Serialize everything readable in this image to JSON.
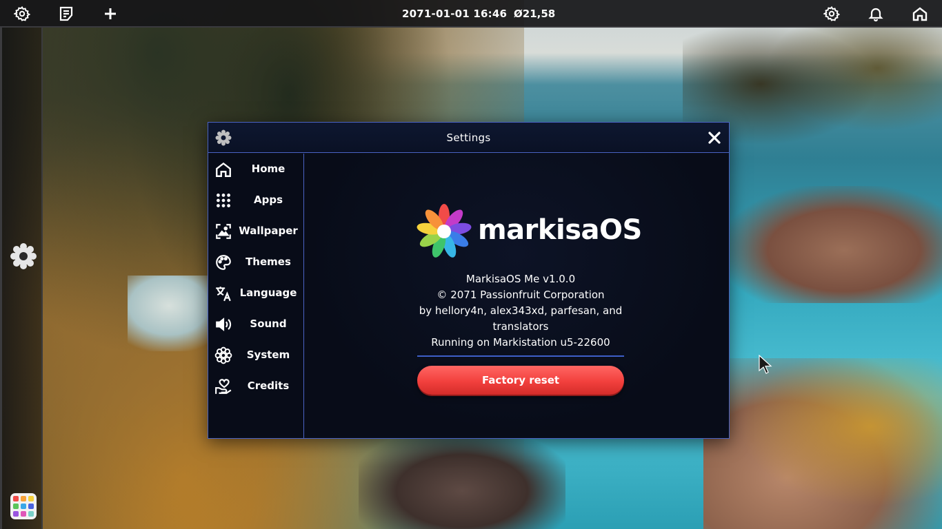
{
  "topbar": {
    "datetime": "2071-01-01 16:46",
    "battery": "Ø21,58",
    "left_icons": [
      "settings-icon",
      "notes-icon",
      "add-icon"
    ],
    "right_icons": [
      "settings-icon",
      "bell-icon",
      "home-icon"
    ]
  },
  "window": {
    "title": "Settings",
    "close_icon": "close-icon"
  },
  "sidebar": {
    "items": [
      {
        "label": "Home",
        "icon": "home-icon"
      },
      {
        "label": "Apps",
        "icon": "apps-grid-icon"
      },
      {
        "label": "Wallpaper",
        "icon": "wallpaper-icon"
      },
      {
        "label": "Themes",
        "icon": "palette-icon"
      },
      {
        "label": "Language",
        "icon": "translate-icon"
      },
      {
        "label": "Sound",
        "icon": "speaker-icon"
      },
      {
        "label": "System",
        "icon": "flower-gear-icon"
      },
      {
        "label": "Credits",
        "icon": "hand-heart-icon"
      }
    ]
  },
  "about": {
    "logo_text": "markisaOS",
    "version": "MarkisaOS Me v1.0.0",
    "copyright": "© 2071 Passionfruit Corporation",
    "authors": "by hellory4n, alex343xd, parfesan, and translators",
    "device": "Running on Markistation u5-22600",
    "factory_reset_label": "Factory reset"
  },
  "colors": {
    "window_bg": "#090d1a",
    "window_border": "#4a63c4",
    "danger_button": "#f2403d",
    "topbar_bg": "#161618"
  }
}
